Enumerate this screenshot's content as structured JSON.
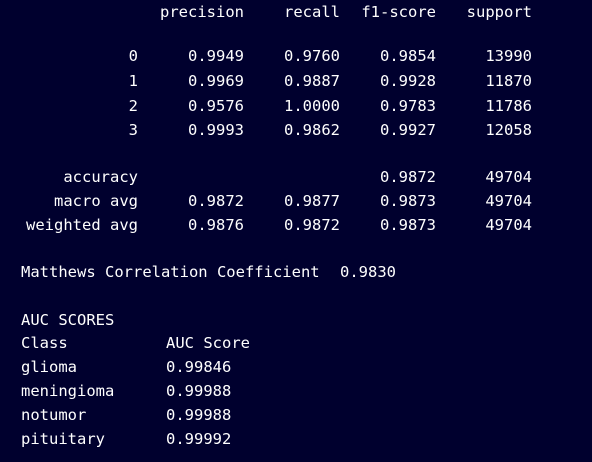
{
  "report": {
    "headers": [
      "precision",
      "recall",
      "f1-score",
      "support"
    ],
    "classes": [
      {
        "label": "0",
        "precision": "0.9949",
        "recall": "0.9760",
        "f1": "0.9854",
        "support": "13990"
      },
      {
        "label": "1",
        "precision": "0.9969",
        "recall": "0.9887",
        "f1": "0.9928",
        "support": "11870"
      },
      {
        "label": "2",
        "precision": "0.9576",
        "recall": "1.0000",
        "f1": "0.9783",
        "support": "11786"
      },
      {
        "label": "3",
        "precision": "0.9993",
        "recall": "0.9862",
        "f1": "0.9927",
        "support": "12058"
      }
    ],
    "accuracy": {
      "label": "accuracy",
      "f1": "0.9872",
      "support": "49704"
    },
    "macro_avg": {
      "label": "macro avg",
      "precision": "0.9872",
      "recall": "0.9877",
      "f1": "0.9873",
      "support": "49704"
    },
    "weighted_avg": {
      "label": "weighted avg",
      "precision": "0.9876",
      "recall": "0.9872",
      "f1": "0.9873",
      "support": "49704"
    }
  },
  "mcc": {
    "label": "Matthews Correlation Coefficient",
    "value": "0.9830"
  },
  "auc": {
    "title": "AUC SCORES",
    "headers": [
      "Class",
      "AUC Score"
    ],
    "rows": [
      {
        "class": "glioma",
        "score": "0.99846"
      },
      {
        "class": "meningioma",
        "score": "0.99988"
      },
      {
        "class": "notumor",
        "score": "0.99988"
      },
      {
        "class": "pituitary",
        "score": "0.99992"
      }
    ]
  }
}
